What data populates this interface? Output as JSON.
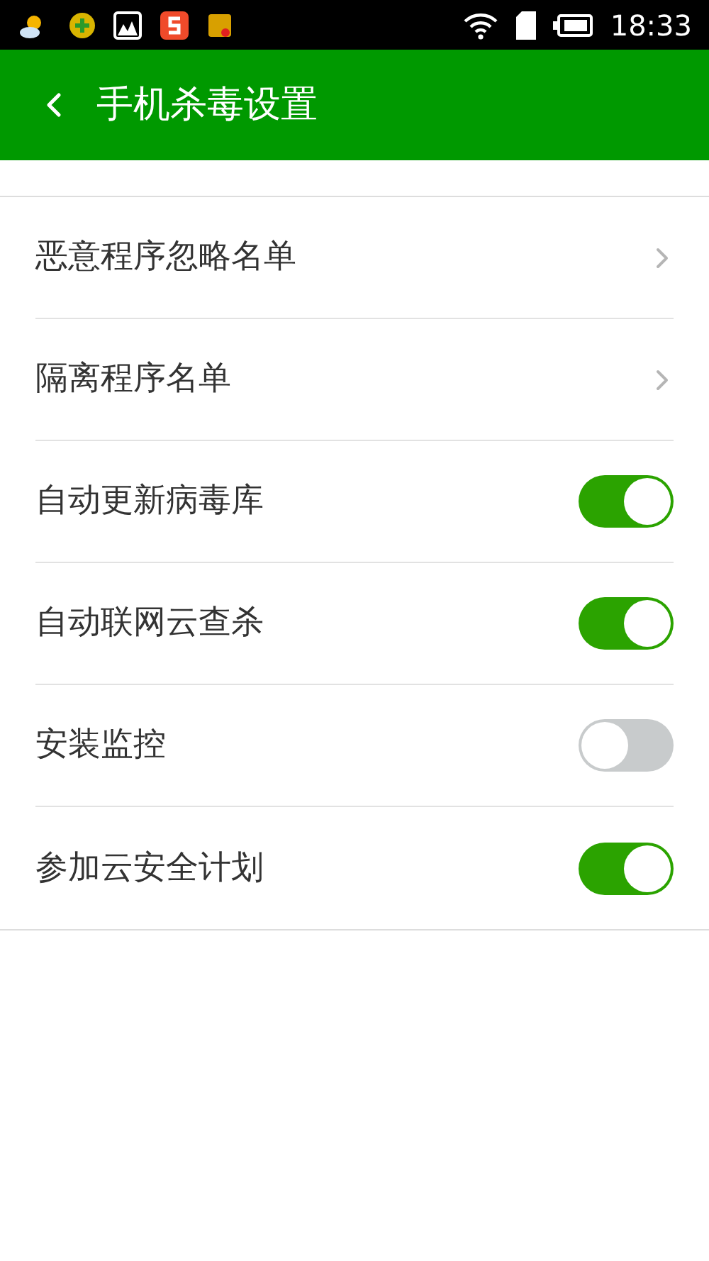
{
  "status_bar": {
    "time": "18:33"
  },
  "header": {
    "title": "手机杀毒设置"
  },
  "settings": [
    {
      "kind": "link",
      "label": "恶意程序忽略名单"
    },
    {
      "kind": "link",
      "label": "隔离程序名单"
    },
    {
      "kind": "switch",
      "label": "自动更新病毒库",
      "on": true
    },
    {
      "kind": "switch",
      "label": "自动联网云查杀",
      "on": true
    },
    {
      "kind": "switch",
      "label": "安装监控",
      "on": false
    },
    {
      "kind": "switch",
      "label": "参加云安全计划",
      "on": true
    }
  ]
}
